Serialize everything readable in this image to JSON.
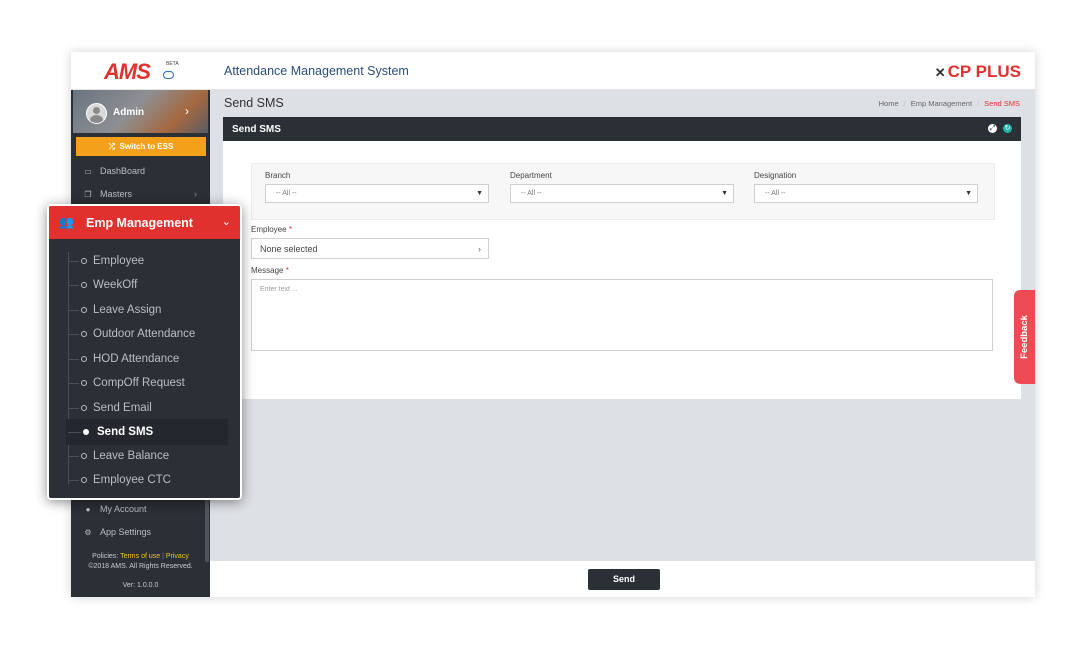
{
  "app": {
    "logo_text": "AMS",
    "logo_badge": "BETA",
    "title": "Attendance Management System",
    "brand": "CP PLUS"
  },
  "user": {
    "name": "Admin"
  },
  "sidebar": {
    "switch_label": "Switch to ESS",
    "items": [
      {
        "label": "DashBoard",
        "icon": "monitor-icon"
      },
      {
        "label": "Masters",
        "icon": "copy-icon"
      },
      {
        "label": "My Account",
        "icon": "user-icon"
      },
      {
        "label": "App Settings",
        "icon": "gears-icon"
      }
    ],
    "footer": {
      "policies_label": "Policies:",
      "terms": "Terms of use",
      "privacy": "Privacy",
      "copyright": "©2018 AMS. All Rights Reserved.",
      "version": "Ver: 1.0.0.0"
    }
  },
  "emp_menu": {
    "title": "Emp Management",
    "items": [
      "Employee",
      "WeekOff",
      "Leave Assign",
      "Outdoor Attendance",
      "HOD Attendance",
      "CompOff Request",
      "Send Email",
      "Send SMS",
      "Leave Balance",
      "Employee CTC"
    ],
    "active": "Send SMS"
  },
  "page": {
    "title": "Send SMS",
    "breadcrumb": [
      "Home",
      "Emp Management",
      "Send SMS"
    ],
    "panel_title": "Send SMS"
  },
  "form": {
    "branch": {
      "label": "Branch",
      "value": "-- All --"
    },
    "department": {
      "label": "Department",
      "value": "-- All --"
    },
    "designation": {
      "label": "Designation",
      "value": "-- All --"
    },
    "employee": {
      "label": "Employee",
      "value": "None selected"
    },
    "message": {
      "label": "Message",
      "placeholder": "Enter text ..."
    },
    "required_mark": "*",
    "send_label": "Send"
  },
  "feedback_label": "Feedback",
  "colors": {
    "accent": "#e0312f",
    "sidebar_bg": "#2b2f36",
    "switch_btn": "#f5a01a",
    "content_bg": "#dde0e5",
    "feedback": "#ef4b55"
  }
}
